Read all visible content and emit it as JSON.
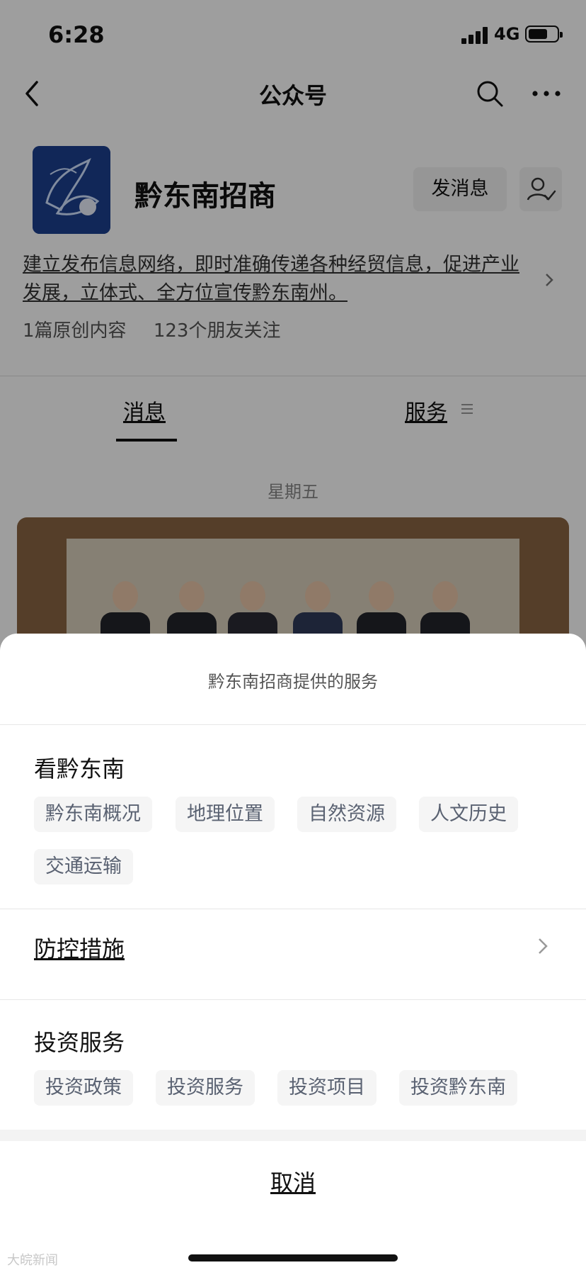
{
  "status_bar": {
    "time": "6:28",
    "network": "4G"
  },
  "nav": {
    "title": "公众号"
  },
  "profile": {
    "name": "黔东南招商",
    "send_message_label": "发消息",
    "intro": "建立发布信息网络，即时准确传递各种经贸信息，促进产业发展，立体式、全方位宣传黔东南州。",
    "original_count": "1篇原创内容",
    "friends_following": "123个朋友关注"
  },
  "tabs": {
    "messages": "消息",
    "services": "服务"
  },
  "feed": {
    "date": "星期五"
  },
  "sheet": {
    "title": "黔东南招商提供的服务",
    "sections": [
      {
        "title": "看黔东南",
        "items": [
          "黔东南概况",
          "地理位置",
          "自然资源",
          "人文历史",
          "交通运输"
        ]
      },
      {
        "title": "防控措施"
      },
      {
        "title": "投资服务",
        "items": [
          "投资政策",
          "投资服务",
          "投资项目",
          "投资黔东南"
        ]
      }
    ],
    "cancel_label": "取消"
  },
  "watermark": "大皖新闻"
}
